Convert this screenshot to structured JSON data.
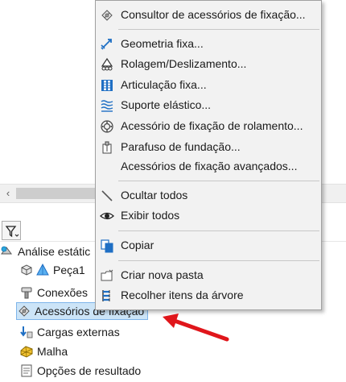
{
  "menu": {
    "items": [
      {
        "label": "Consultor de acessórios de fixação...",
        "icon": "advisor-icon"
      },
      {
        "label": "Geometria fixa...",
        "icon": "fixed-geometry-icon"
      },
      {
        "label": "Rolagem/Deslizamento...",
        "icon": "roller-slider-icon"
      },
      {
        "label": "Articulação fixa...",
        "icon": "fixed-hinge-icon"
      },
      {
        "label": "Suporte elástico...",
        "icon": "elastic-support-icon"
      },
      {
        "label": "Acessório de fixação de rolamento...",
        "icon": "bearing-fixture-icon"
      },
      {
        "label": "Parafuso de fundação...",
        "icon": "foundation-bolt-icon"
      },
      {
        "label": "Acessórios de fixação avançados...",
        "icon": ""
      },
      {
        "label": "Ocultar todos",
        "icon": "hide-all-icon"
      },
      {
        "label": "Exibir todos",
        "icon": "eye-icon"
      },
      {
        "label": "Copiar",
        "icon": "copy-icon"
      },
      {
        "label": "Criar nova pasta",
        "icon": "new-folder-icon"
      },
      {
        "label": "Recolher itens da árvore",
        "icon": "collapse-tree-icon"
      }
    ]
  },
  "tree": {
    "root": "Análise estátic",
    "items": [
      {
        "label": "Peça1",
        "icon": "part-icon"
      },
      {
        "label": "Conexões",
        "icon": "connections-icon"
      },
      {
        "label": "Acessórios de fixação",
        "icon": "fixtures-icon",
        "selected": true
      },
      {
        "label": "Cargas externas",
        "icon": "external-loads-icon"
      },
      {
        "label": "Malha",
        "icon": "mesh-icon"
      },
      {
        "label": "Opções de resultado",
        "icon": "result-options-icon"
      }
    ]
  },
  "colors": {
    "selection_bg": "#cce4f7",
    "selection_border": "#7eb4ea",
    "menu_bg": "#f2f2f2",
    "annotation_arrow": "#e0161b",
    "icon_blue": "#1f6fc4"
  }
}
